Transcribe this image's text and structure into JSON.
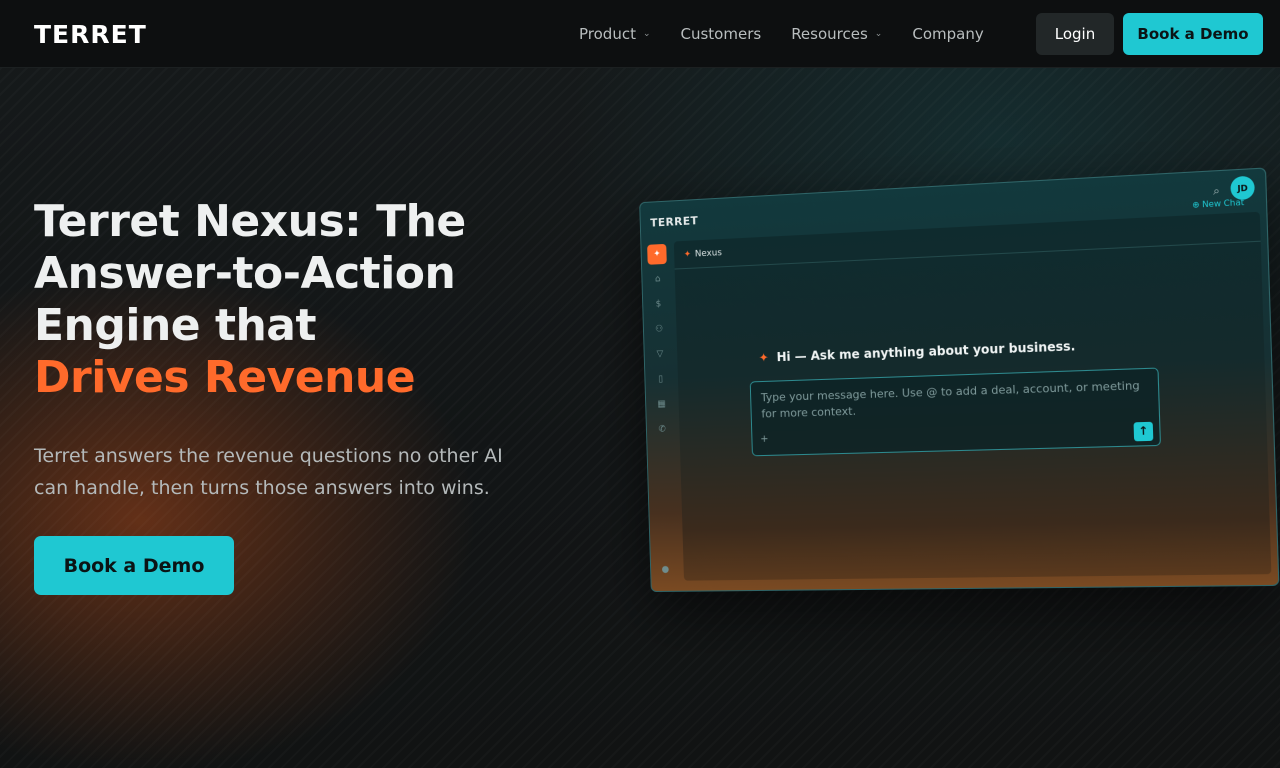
{
  "nav": {
    "logo": "TERRET",
    "links": [
      {
        "label": "Product",
        "has_menu": true
      },
      {
        "label": "Customers",
        "has_menu": false
      },
      {
        "label": "Resources",
        "has_menu": true
      },
      {
        "label": "Company",
        "has_menu": false
      }
    ],
    "login_label": "Login",
    "demo_label": "Book a Demo",
    "chevron": "⌄"
  },
  "hero": {
    "title_line1": "Terret Nexus: The",
    "title_line2": "Answer-to-Action",
    "title_line3": "Engine that",
    "title_accent": "Drives Revenue",
    "subtitle": "Terret answers the revenue questions no other AI can handle, then turns those answers into wins.",
    "cta_label": "Book a Demo"
  },
  "mockup": {
    "logo": "TERRET",
    "avatar_initials": "JD",
    "new_chat_label": "New Chat",
    "tab_label": "Nexus",
    "greeting": "Hi — Ask me anything about your business.",
    "input_placeholder": "Type your message here. Use @ to add a deal, account, or meeting for more context.",
    "sidebar_icons": [
      "sparkle-icon",
      "home-icon",
      "dollar-icon",
      "users-icon",
      "filter-icon",
      "document-icon",
      "calendar-icon",
      "phone-icon"
    ],
    "icons": {
      "search": "⌕",
      "sparkle": "✦",
      "send": "↑",
      "attach": "+",
      "new_chat": "⊕"
    }
  },
  "colors": {
    "accent_orange": "#ff6a2b",
    "accent_cyan": "#1fc8d2",
    "background": "#121516"
  }
}
